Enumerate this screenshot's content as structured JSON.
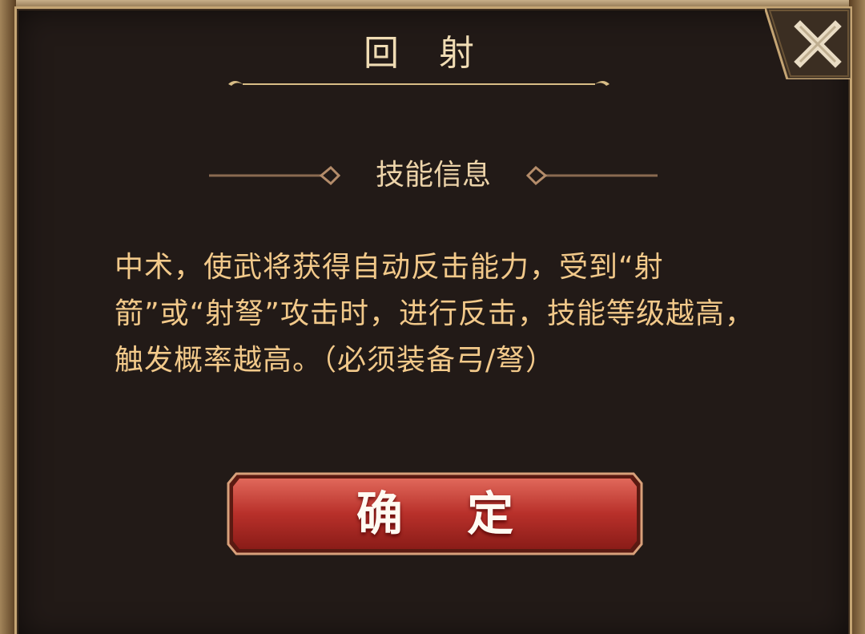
{
  "dialog": {
    "title": "回 射",
    "section_title": "技能信息",
    "description": "中术，使武将获得自动反击能力，受到“射箭”或“射弩”攻击时，进行反击，技能等级越高，触发概率越高。（必须装备弓/弩）",
    "confirm_label": "确 定",
    "close_icon": "close-x-icon"
  },
  "colors": {
    "panel_bg": "#221a17",
    "frame_gold": "#c5a574",
    "title_text": "#f0dcb4",
    "desc_text": "#f2c98a",
    "button_red": "#c0392b"
  }
}
